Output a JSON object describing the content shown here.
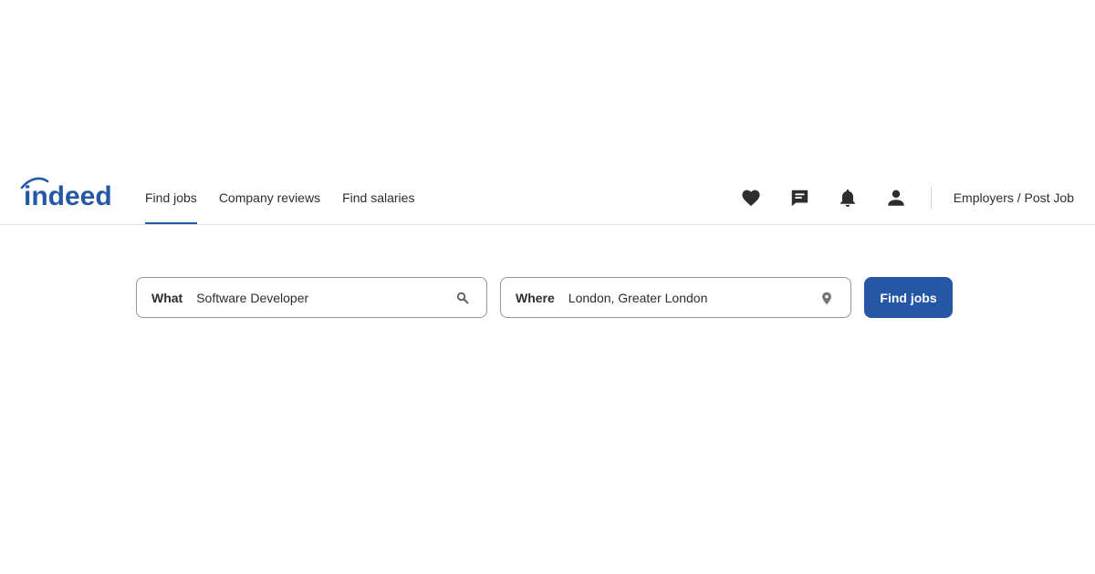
{
  "header": {
    "logo_text": "indeed",
    "brand_color": "#2557a7",
    "nav": [
      {
        "label": "Find jobs",
        "active": true
      },
      {
        "label": "Company reviews",
        "active": false
      },
      {
        "label": "Find salaries",
        "active": false
      }
    ],
    "icons": [
      "heart-icon",
      "messages-icon",
      "bell-icon",
      "account-icon"
    ],
    "employers_label": "Employers / Post Job"
  },
  "search": {
    "what_label": "What",
    "what_value": "Software Developer",
    "where_label": "Where",
    "where_value": "London, Greater London",
    "button_label": "Find jobs"
  }
}
